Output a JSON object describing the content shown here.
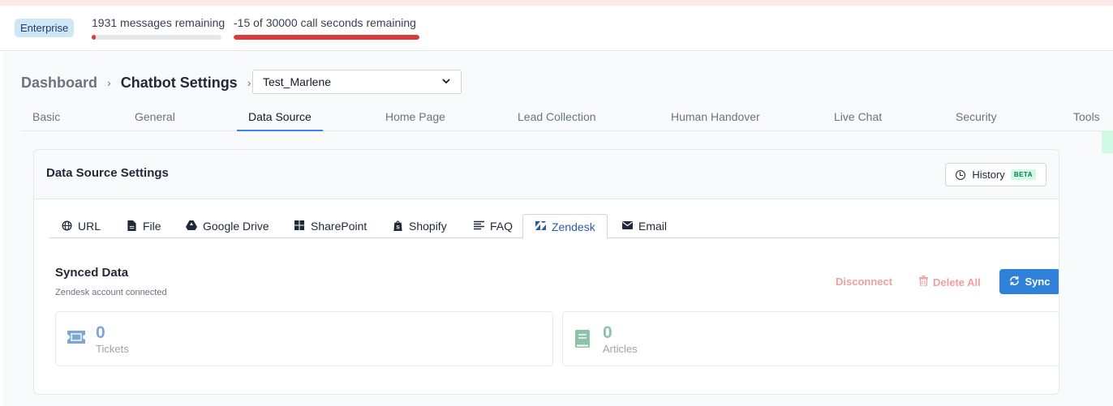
{
  "usage": {
    "plan": "Enterprise",
    "messages_label": "1931 messages remaining",
    "messages_fraction": 0.03,
    "calls_label": "-15 of 30000 call seconds remaining",
    "calls_fraction": 1.0
  },
  "breadcrumb": {
    "dashboard": "Dashboard",
    "settings": "Chatbot Settings",
    "separator": "›",
    "selected_bot": "Test_Marlene"
  },
  "tabs": [
    "Basic",
    "General",
    "Data Source",
    "Home Page",
    "Lead Collection",
    "Human Handover",
    "Live Chat",
    "Security",
    "Tools"
  ],
  "active_tab": "Data Source",
  "card": {
    "title": "Data Source Settings",
    "history_label": "History",
    "beta_label": "BETA"
  },
  "source_tabs": [
    {
      "label": "URL",
      "icon": "globe-icon"
    },
    {
      "label": "File",
      "icon": "file-icon"
    },
    {
      "label": "Google Drive",
      "icon": "google-drive-icon"
    },
    {
      "label": "SharePoint",
      "icon": "sharepoint-icon"
    },
    {
      "label": "Shopify",
      "icon": "shopify-icon"
    },
    {
      "label": "FAQ",
      "icon": "list-icon"
    },
    {
      "label": "Zendesk",
      "icon": "zendesk-icon"
    },
    {
      "label": "Email",
      "icon": "envelope-icon"
    }
  ],
  "active_source": "Zendesk",
  "synced": {
    "title": "Synced Data",
    "subtitle": "Zendesk account connected",
    "disconnect": "Disconnect",
    "delete_all": "Delete All",
    "sync": "Sync"
  },
  "stats": [
    {
      "value": "0",
      "label": "Tickets",
      "icon": "ticket-icon",
      "color": "#7aa7d6"
    },
    {
      "value": "0",
      "label": "Articles",
      "icon": "book-icon",
      "color": "#8cc2a7"
    }
  ],
  "colors": {
    "accent": "#2f80d8",
    "danger": "#dc3a3a",
    "danger_muted": "#f0a0a0"
  }
}
